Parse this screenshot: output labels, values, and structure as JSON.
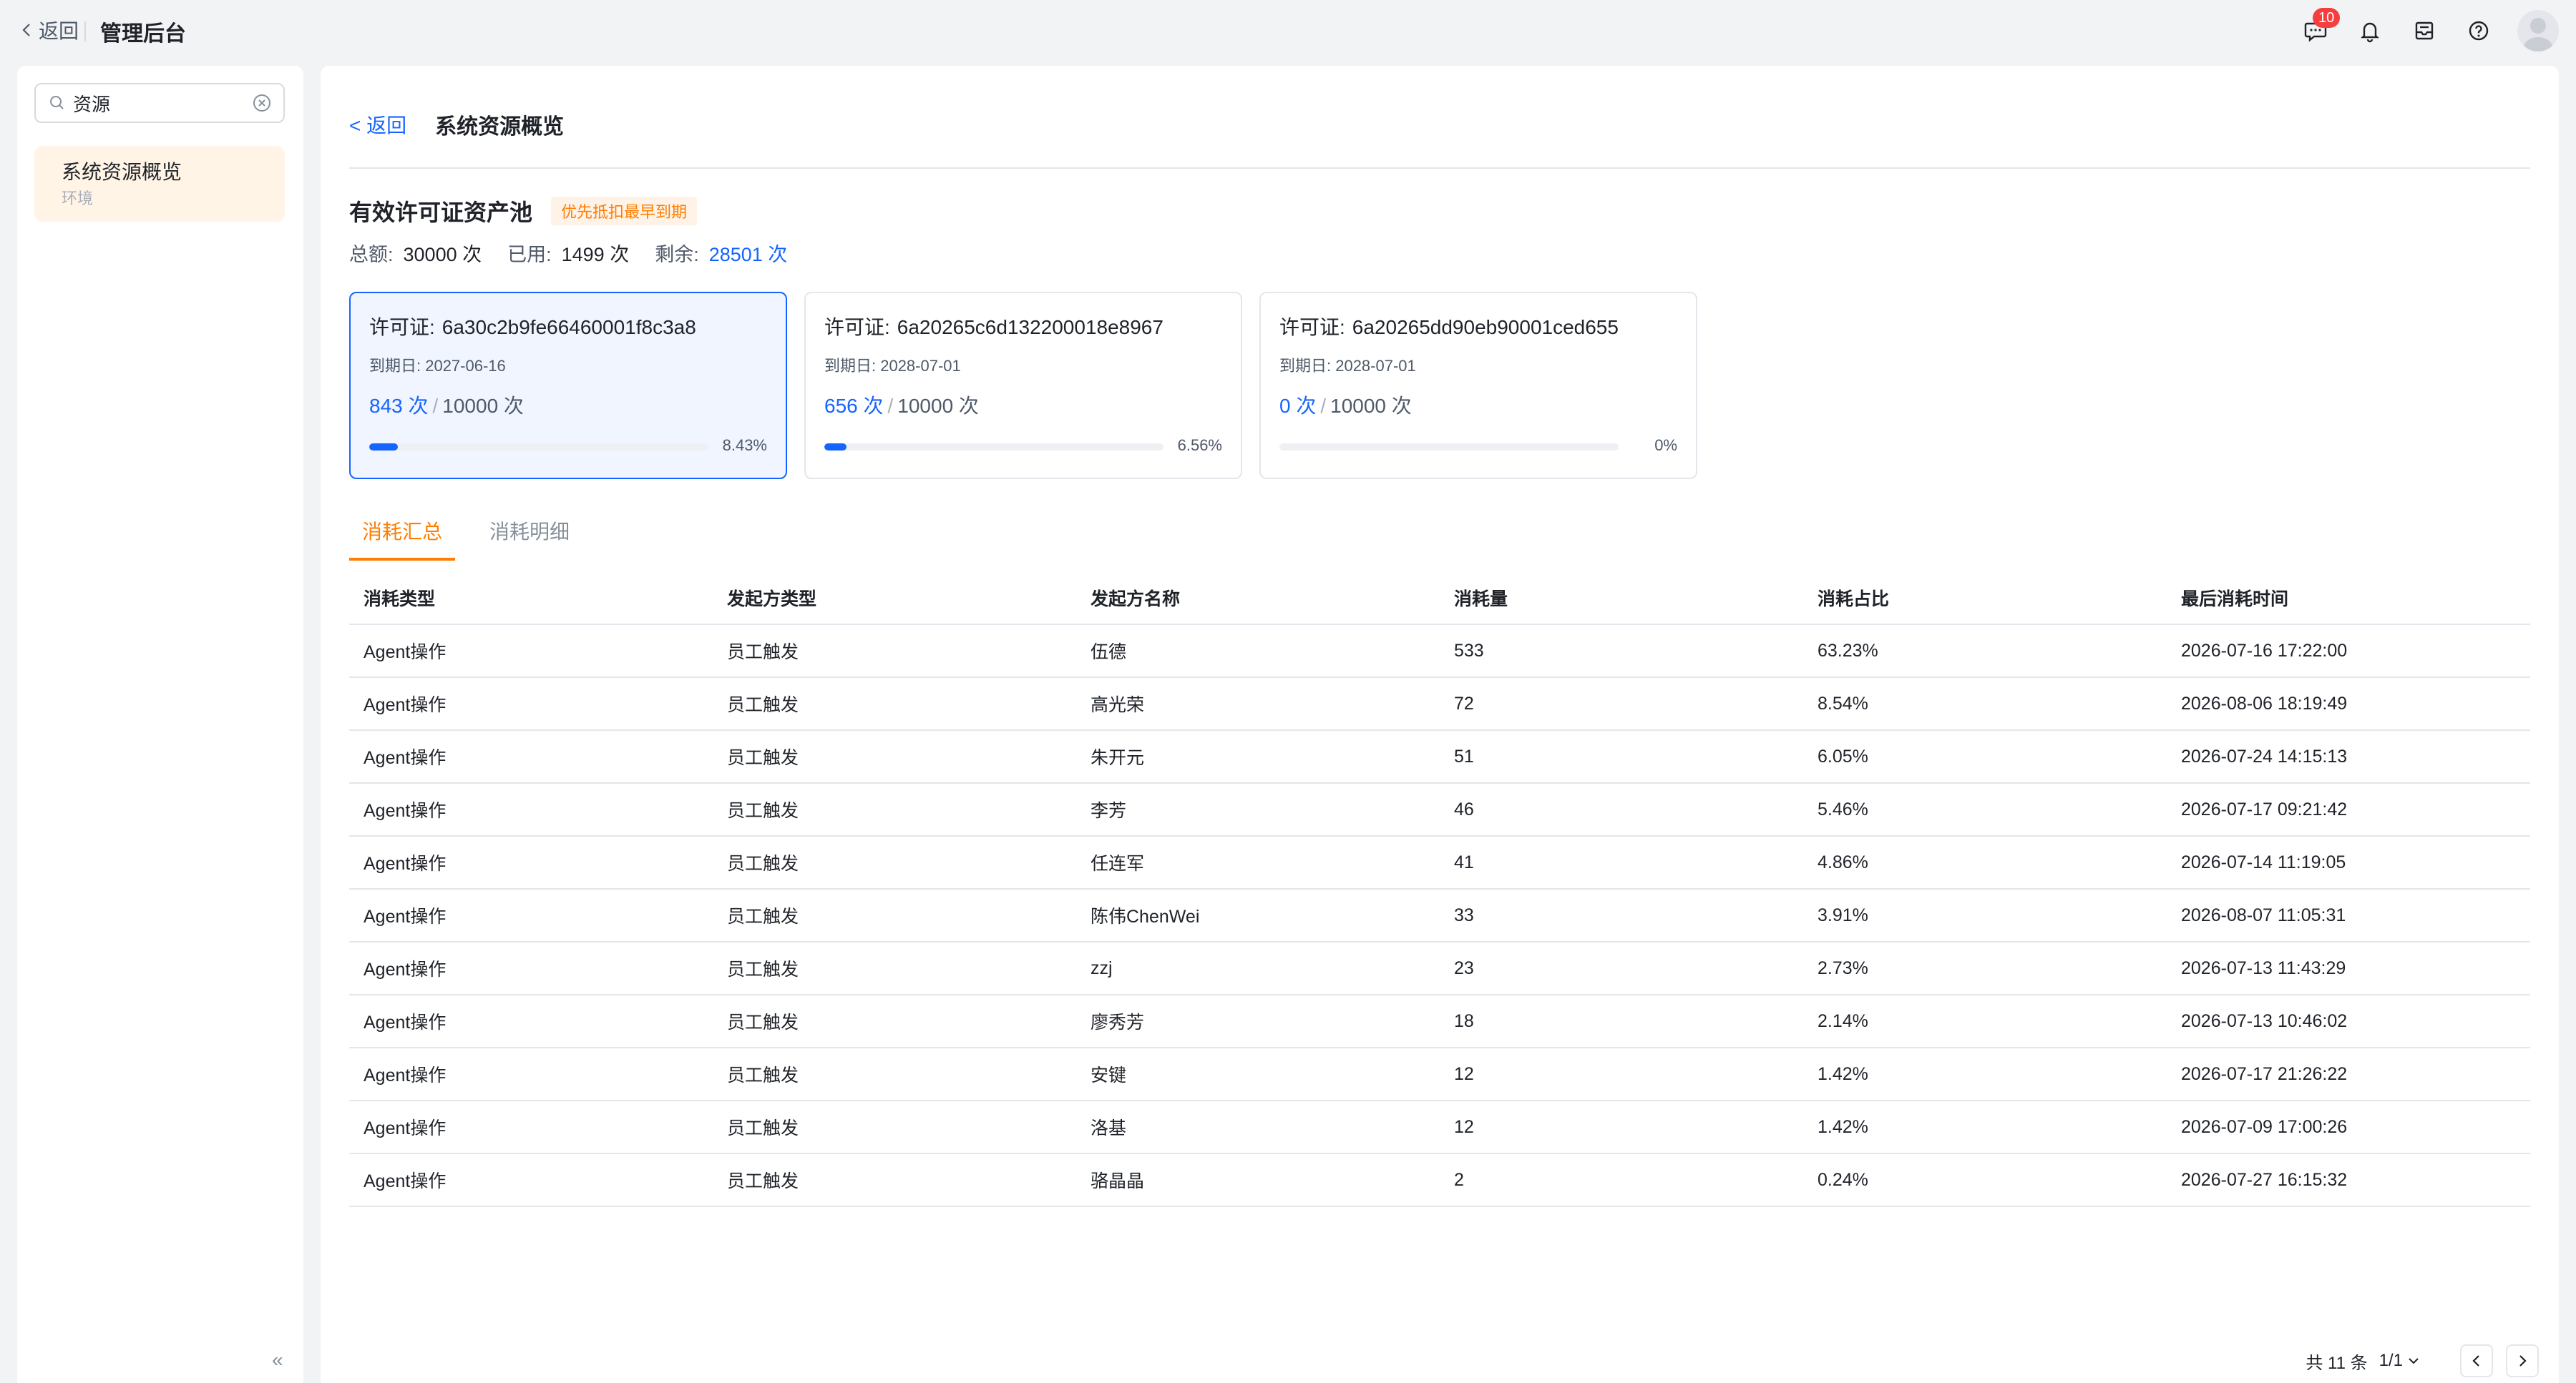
{
  "topbar": {
    "back_label": "返回",
    "title": "管理后台",
    "message_badge": "10"
  },
  "sidebar": {
    "search_value": "资源",
    "item_label": "系统资源概览",
    "item_sub": "环境",
    "collapse_glyph": "«"
  },
  "main": {
    "back_link": "< 返回",
    "page_title": "系统资源概览",
    "pool_title": "有效许可证资产池",
    "pool_tag": "优先抵扣最早到期",
    "stats": {
      "total_label": "总额:",
      "total_value": "30000 次",
      "used_label": "已用:",
      "used_value": "1499 次",
      "remain_label": "剩余:",
      "remain_value": "28501 次"
    }
  },
  "cards": [
    {
      "title_label": "许可证:",
      "id": "6a30c2b9fe66460001f8c3a8",
      "expiry": "到期日: 2027-06-16",
      "used": "843 次",
      "sep": "/",
      "total": "10000 次",
      "percent": "8.43%",
      "progress": 0.0843
    },
    {
      "title_label": "许可证:",
      "id": "6a20265c6d132200018e8967",
      "expiry": "到期日: 2028-07-01",
      "used": "656 次",
      "sep": "/",
      "total": "10000 次",
      "percent": "6.56%",
      "progress": 0.0656
    },
    {
      "title_label": "许可证:",
      "id": "6a20265dd90eb90001ced655",
      "expiry": "到期日: 2028-07-01",
      "used": "0 次",
      "sep": "/",
      "total": "10000 次",
      "percent": "0%",
      "progress": 0
    }
  ],
  "tabs": [
    "消耗汇总",
    "消耗明细"
  ],
  "table": {
    "headers": [
      "消耗类型",
      "发起方类型",
      "发起方名称",
      "消耗量",
      "消耗占比",
      "最后消耗时间"
    ],
    "rows": [
      [
        "Agent操作",
        "员工触发",
        "伍德",
        "533",
        "63.23%",
        "2026-07-16 17:22:00"
      ],
      [
        "Agent操作",
        "员工触发",
        "高光荣",
        "72",
        "8.54%",
        "2026-08-06 18:19:49"
      ],
      [
        "Agent操作",
        "员工触发",
        "朱开元",
        "51",
        "6.05%",
        "2026-07-24 14:15:13"
      ],
      [
        "Agent操作",
        "员工触发",
        "李芳",
        "46",
        "5.46%",
        "2026-07-17 09:21:42"
      ],
      [
        "Agent操作",
        "员工触发",
        "任连军",
        "41",
        "4.86%",
        "2026-07-14 11:19:05"
      ],
      [
        "Agent操作",
        "员工触发",
        "陈伟ChenWei",
        "33",
        "3.91%",
        "2026-08-07 11:05:31"
      ],
      [
        "Agent操作",
        "员工触发",
        "zzj",
        "23",
        "2.73%",
        "2026-07-13 11:43:29"
      ],
      [
        "Agent操作",
        "员工触发",
        "廖秀芳",
        "18",
        "2.14%",
        "2026-07-13 10:46:02"
      ],
      [
        "Agent操作",
        "员工触发",
        "安键",
        "12",
        "1.42%",
        "2026-07-17 21:26:22"
      ],
      [
        "Agent操作",
        "员工触发",
        "洛基",
        "12",
        "1.42%",
        "2026-07-09 17:00:26"
      ],
      [
        "Agent操作",
        "员工触发",
        "骆晶晶",
        "2",
        "0.24%",
        "2026-07-27 16:15:32"
      ]
    ]
  },
  "pager": {
    "total": "共 11 条",
    "page_info": "1/1"
  }
}
